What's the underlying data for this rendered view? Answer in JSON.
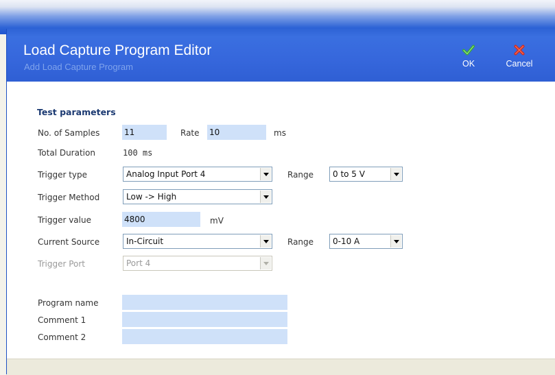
{
  "window": {
    "title": "Load Capture Program Editor",
    "subtitle": "Add Load Capture Program"
  },
  "toolbar": {
    "ok_label": "OK",
    "cancel_label": "Cancel"
  },
  "test_parameters": {
    "heading": "Test parameters",
    "samples_label": "No. of Samples",
    "samples_value": "11",
    "rate_label": "Rate",
    "rate_value": "10",
    "rate_unit": "ms",
    "total_duration_label": "Total Duration",
    "total_duration_value": "100 ms",
    "trigger_type_label": "Trigger type",
    "trigger_type_value": "Analog Input Port 4",
    "trigger_range_label": "Range",
    "trigger_range_value": "0 to 5 V",
    "trigger_method_label": "Trigger Method",
    "trigger_method_value": "Low -> High",
    "trigger_value_label": "Trigger value",
    "trigger_value_value": "4800",
    "trigger_value_unit": "mV",
    "current_source_label": "Current Source",
    "current_source_value": "In-Circuit",
    "current_range_label": "Range",
    "current_range_value": "0-10 A",
    "trigger_port_label": "Trigger Port",
    "trigger_port_value": "Port 4"
  },
  "program": {
    "name_label": "Program name",
    "name_value": "",
    "comment1_label": "Comment 1",
    "comment1_value": "",
    "comment2_label": "Comment 2",
    "comment2_value": ""
  },
  "colors": {
    "titlebar": "#3466dc",
    "field_background": "#cfe1f9",
    "heading_text": "#1c3a72",
    "ok_icon": "#3aa53a",
    "cancel_icon": "#d42a1c"
  }
}
